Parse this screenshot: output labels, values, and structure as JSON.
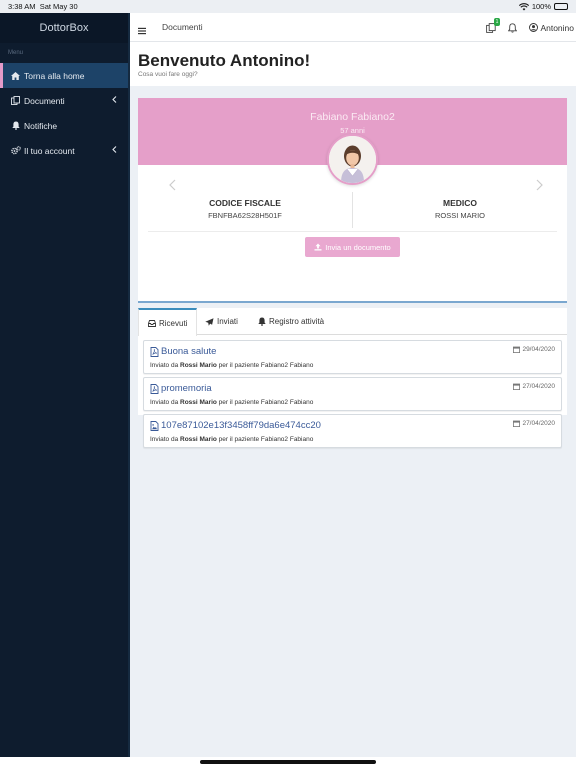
{
  "status_bar": {
    "time": "3:38 AM",
    "date": "Sat May 30",
    "battery": "100%"
  },
  "sidebar": {
    "brand": "DottorBox",
    "menu_header": "Menu",
    "items": [
      {
        "label": "Torna alla home",
        "icon": "home-icon",
        "active": true
      },
      {
        "label": "Documenti",
        "icon": "documents-icon",
        "has_submenu": true
      },
      {
        "label": "Notifiche",
        "icon": "bell-icon"
      },
      {
        "label": "Il tuo account",
        "icon": "gears-icon",
        "has_submenu": true
      }
    ]
  },
  "topbar": {
    "breadcrumb": "Documenti",
    "notification_badge": "1",
    "username": "Antonino"
  },
  "header": {
    "welcome": "Benvenuto Antonino!",
    "subtitle": "Cosa vuoi fare oggi?"
  },
  "patient": {
    "name": "Fabiano Fabiano2",
    "age": "57 anni",
    "codice_fiscale_label": "CODICE FISCALE",
    "codice_fiscale_value": "FBNFBA62S28H501F",
    "medico_label": "MEDICO",
    "medico_value": "ROSSI MARIO",
    "send_button": "Invia un documento"
  },
  "tabs": [
    {
      "label": "Ricevuti",
      "active": true
    },
    {
      "label": "Inviati"
    },
    {
      "label": "Registro attività"
    }
  ],
  "documents": [
    {
      "title": "Buona salute",
      "date": "29/04/2020",
      "sent_prefix": "Inviato da",
      "sender": "Rossi Mario",
      "patient_text": "per il paziente Fabiano2 Fabiano",
      "icon": "pdf-file-icon"
    },
    {
      "title": "promemoria",
      "date": "27/04/2020",
      "sent_prefix": "Inviato da",
      "sender": "Rossi Mario",
      "patient_text": "per il paziente Fabiano2 Fabiano",
      "icon": "pdf-file-icon"
    },
    {
      "title": "107e87102e13f3458ff79da6e474cc20",
      "date": "27/04/2020",
      "sent_prefix": "Inviato da",
      "sender": "Rossi Mario",
      "patient_text": "per il paziente Fabiano2 Fabiano",
      "icon": "image-file-icon"
    }
  ],
  "colors": {
    "sidebar_bg": "#0e1c2e",
    "active_item_bg": "#1d4368",
    "accent_pink": "#e59fc9",
    "link_blue": "#3a5a98",
    "tab_accent": "#3c8dbc"
  }
}
